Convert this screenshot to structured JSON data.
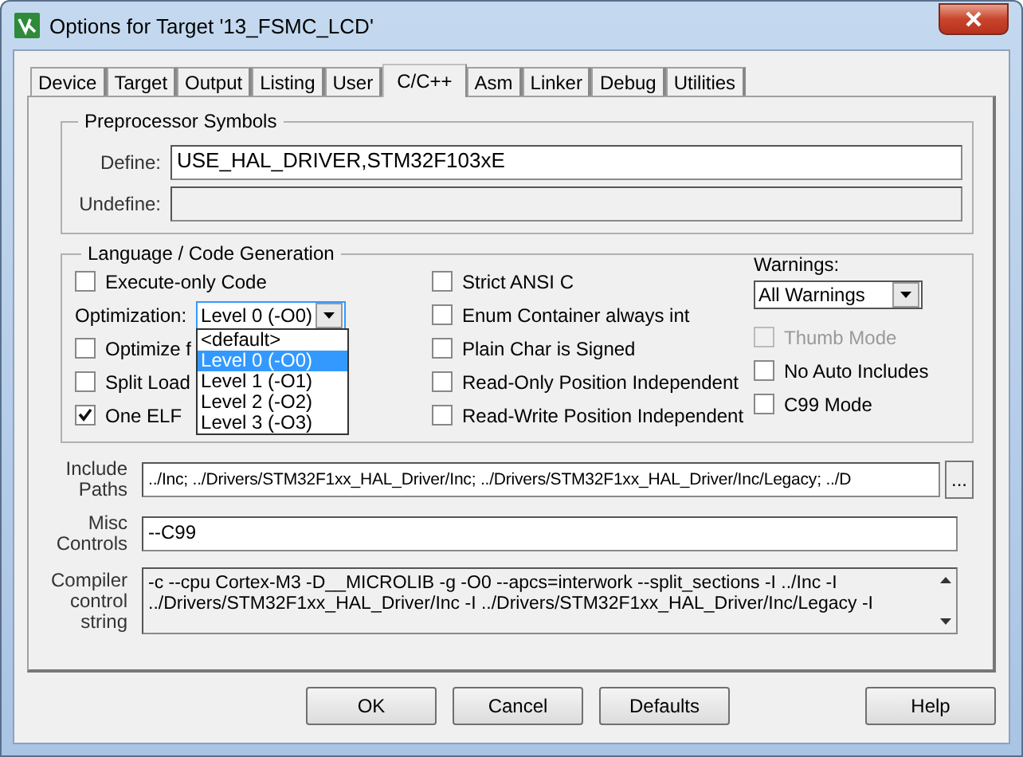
{
  "window": {
    "title": "Options for Target '13_FSMC_LCD'"
  },
  "tabs": [
    {
      "label": "Device",
      "selected": false
    },
    {
      "label": "Target",
      "selected": false
    },
    {
      "label": "Output",
      "selected": false
    },
    {
      "label": "Listing",
      "selected": false
    },
    {
      "label": "User",
      "selected": false
    },
    {
      "label": "C/C++",
      "selected": true
    },
    {
      "label": "Asm",
      "selected": false
    },
    {
      "label": "Linker",
      "selected": false
    },
    {
      "label": "Debug",
      "selected": false
    },
    {
      "label": "Utilities",
      "selected": false
    }
  ],
  "preprocessor": {
    "title": "Preprocessor Symbols",
    "define": {
      "label": "Define:",
      "value": "USE_HAL_DRIVER,STM32F103xE"
    },
    "undefine": {
      "label": "Undefine:"
    }
  },
  "language": {
    "title": "Language / Code Generation",
    "left": [
      {
        "kind": "checkbox",
        "label": "Execute-only Code",
        "checked": false
      },
      {
        "kind": "select",
        "label": "Optimization:",
        "value": "Level 0 (-O0)",
        "expanded": true,
        "options": [
          {
            "label": "<default>",
            "selected": false
          },
          {
            "label": "Level 0 (-O0)",
            "selected": true
          },
          {
            "label": "Level 1 (-O1)",
            "selected": false
          },
          {
            "label": "Level 2 (-O2)",
            "selected": false
          },
          {
            "label": "Level 3 (-O3)",
            "selected": false
          }
        ]
      },
      {
        "kind": "checkbox",
        "label": "Optimize f",
        "checked": false
      },
      {
        "kind": "checkbox",
        "label": "Split Load",
        "checked": false
      },
      {
        "kind": "checkbox",
        "label": "One ELF",
        "checked": true
      }
    ],
    "middle": [
      {
        "kind": "checkbox",
        "label": "Strict ANSI C",
        "checked": false
      },
      {
        "kind": "checkbox",
        "label": "Enum Container always int",
        "checked": false
      },
      {
        "kind": "checkbox",
        "label": "Plain Char is Signed",
        "checked": false
      },
      {
        "kind": "checkbox",
        "label": "Read-Only Position Independent",
        "checked": false
      },
      {
        "kind": "checkbox",
        "label": "Read-Write Position Independent",
        "checked": false
      }
    ],
    "right": [
      {
        "kind": "select",
        "label": "Warnings:",
        "value": "All Warnings"
      },
      {
        "kind": "checkbox",
        "label": "Thumb Mode",
        "checked": false,
        "disabled": true
      },
      {
        "kind": "checkbox",
        "label": "No Auto Includes",
        "checked": false,
        "disabled": false
      },
      {
        "kind": "checkbox",
        "label": "C99 Mode",
        "checked": false,
        "disabled": false
      }
    ]
  },
  "include_paths": {
    "label": "Include Paths",
    "value": "../Inc; ../Drivers/STM32F1xx_HAL_Driver/Inc; ../Drivers/STM32F1xx_HAL_Driver/Inc/Legacy; ../D",
    "browse": "..."
  },
  "misc_controls": {
    "label": "Misc Controls",
    "value": "--C99"
  },
  "compiler_string": {
    "label": "Compiler control string",
    "lines": [
      "-c --cpu Cortex-M3 -D__MICROLIB -g -O0 --apcs=interwork --split_sections -I ../Inc -I",
      "../Drivers/STM32F1xx_HAL_Driver/Inc -I ../Drivers/STM32F1xx_HAL_Driver/Inc/Legacy -I"
    ]
  },
  "buttons": [
    "OK",
    "Cancel",
    "Defaults"
  ],
  "help_button": "Help"
}
